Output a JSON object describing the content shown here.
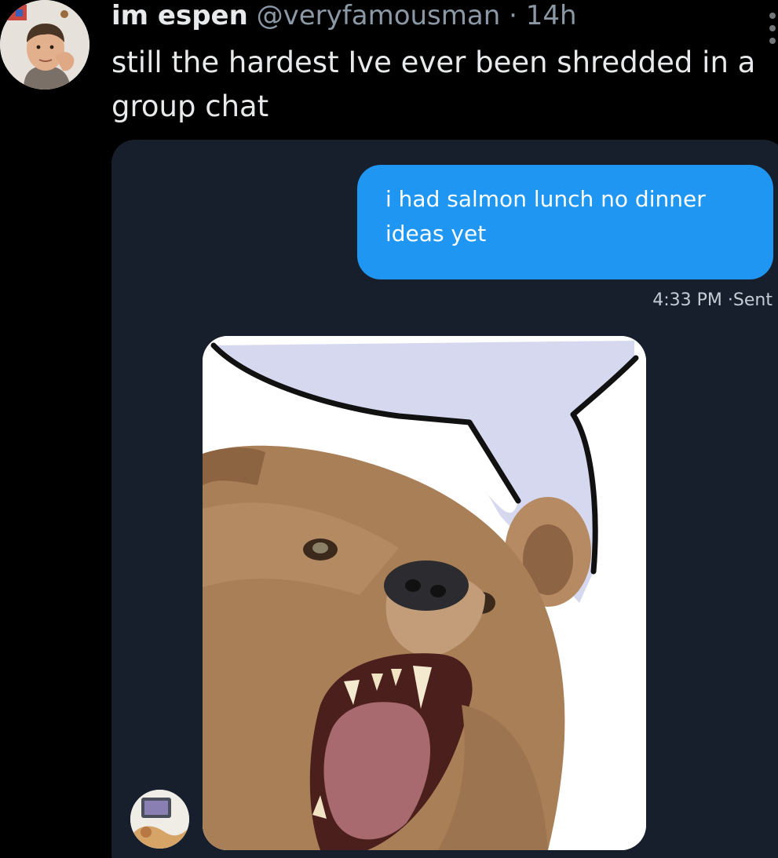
{
  "tweet": {
    "author_name": "im espen",
    "author_handle": "@veryfamousman",
    "separator": "·",
    "age": "14h",
    "text": "still the hardest Ive ever been shredded in a group chat"
  },
  "chat": {
    "sent_message": "i had salmon lunch no dinner ideas yet",
    "time": "4:33 PM",
    "meta_separator": "·",
    "status": "Sent",
    "reply_image": "bear-roaring-with-speech-bubble"
  },
  "colors": {
    "background": "#000000",
    "chat_background": "#161f2b",
    "bubble_blue": "#1f97f2",
    "speech_bubble_fill": "#d4d6ee"
  },
  "icons": {
    "more": "vertical-ellipsis-icon"
  }
}
